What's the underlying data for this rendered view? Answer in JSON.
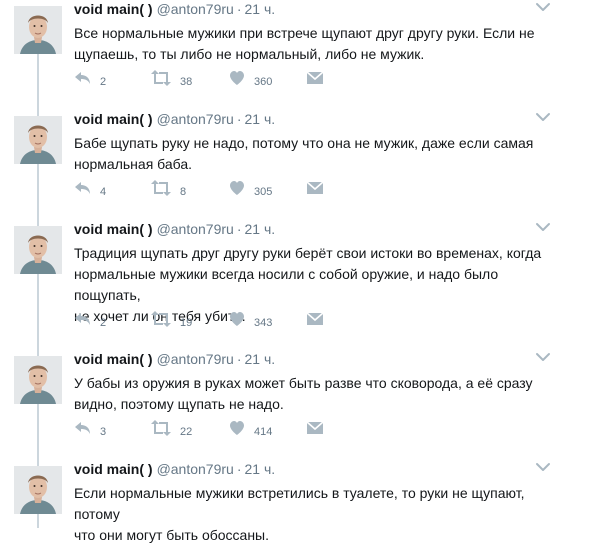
{
  "tweets": [
    {
      "name": "void main( )",
      "handle": "@anton79ru",
      "separator": "·",
      "time": "21 ч.",
      "lines": [
        "Все нормальные мужики при встрече щупают друг другу руки. Если не",
        "щупаешь, то ты либо не нормальный, либо не мужик."
      ],
      "replies": "2",
      "retweets": "38",
      "likes": "360"
    },
    {
      "name": "void main( )",
      "handle": "@anton79ru",
      "separator": "·",
      "time": "21 ч.",
      "lines": [
        "Бабе щупать руку не надо, потому что она не мужик, даже если самая",
        "нормальная баба."
      ],
      "replies": "4",
      "retweets": "8",
      "likes": "305"
    },
    {
      "name": "void main( )",
      "handle": "@anton79ru",
      "separator": "·",
      "time": "21 ч.",
      "lines": [
        "Традиция щупать друг другу руки берёт свои истоки во временах, когда",
        "нормальные мужики всегда носили с собой оружие, и надо было пощупать,",
        "не хочет ли он тебя убить."
      ],
      "replies": "2",
      "retweets": "19",
      "likes": "343"
    },
    {
      "name": "void main( )",
      "handle": "@anton79ru",
      "separator": "·",
      "time": "21 ч.",
      "lines": [
        "У бабы из оружия в руках может быть разве что сковорода, а её сразу",
        "видно, поэтому щупать не надо."
      ],
      "replies": "3",
      "retweets": "22",
      "likes": "414"
    },
    {
      "name": "void main( )",
      "handle": "@anton79ru",
      "separator": "·",
      "time": "21 ч.",
      "lines": [
        "Если нормальные мужики встретились в туалете, то руки не щупают, потому",
        "что они могут быть обоссаны."
      ]
    }
  ],
  "icons": {
    "reply": "reply-icon",
    "retweet": "retweet-icon",
    "like": "heart-icon",
    "message": "envelope-icon",
    "more": "chevron-down-icon",
    "avatar": "avatar"
  },
  "colors": {
    "text": "#14171a",
    "secondary": "#657786",
    "icon": "#aab8c2",
    "thread_line": "#ccd6dd"
  }
}
